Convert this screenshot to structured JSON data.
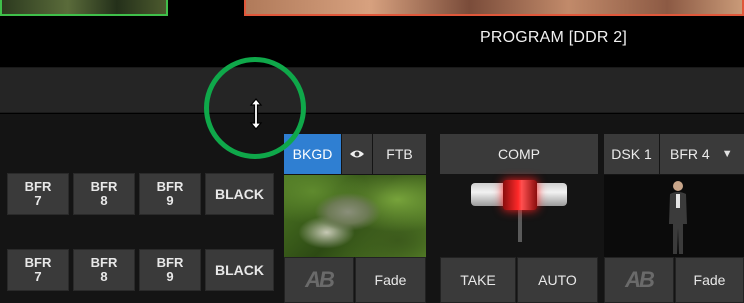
{
  "program": {
    "label": "PROGRAM [DDR 2]"
  },
  "row1": [
    {
      "line1": "BFR",
      "line2": "7"
    },
    {
      "line1": "BFR",
      "line2": "8"
    },
    {
      "line1": "BFR",
      "line2": "9"
    }
  ],
  "row1_black": "BLACK",
  "row2": [
    {
      "line1": "BFR",
      "line2": "7"
    },
    {
      "line1": "BFR",
      "line2": "8"
    },
    {
      "line1": "BFR",
      "line2": "9"
    }
  ],
  "row2_black": "BLACK",
  "transition": {
    "bkgd_tab": "BKGD",
    "ftb_tab": "FTB",
    "bkgd_fade": "Fade",
    "ab_icon_text": "AB"
  },
  "comp": {
    "label": "COMP",
    "take": "TAKE",
    "auto": "AUTO"
  },
  "dsk": {
    "tab": "DSK 1",
    "source": "BFR 4",
    "fade": "Fade",
    "ab_icon_text": "AB"
  },
  "colors": {
    "accent_blue": "#2f7fd2",
    "highlight_green": "#0fa84a",
    "tbar_red": "#ff2a2a"
  }
}
